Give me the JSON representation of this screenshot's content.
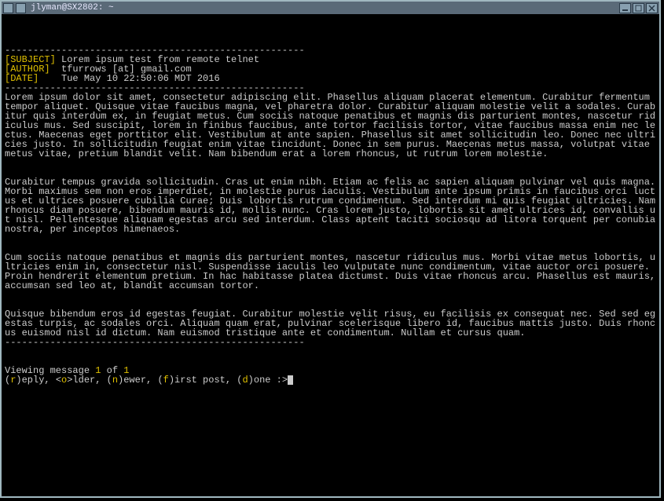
{
  "titlebar": {
    "title": "jlyman@SX2802: ~"
  },
  "header": {
    "rule": "-----------------------------------------------------",
    "subject_label": "[SUBJECT]",
    "subject_value": "Lorem ipsum test from remote telnet",
    "author_label": "[AUTHOR]",
    "author_value": "tfurrows [at] gmail.com",
    "date_label": "[DATE]",
    "date_value": "Tue May 10 22:50:06 MDT 2016"
  },
  "body": {
    "para1": "Lorem ipsum dolor sit amet, consectetur adipiscing elit. Phasellus aliquam placerat elementum. Curabitur fermentum tempor aliquet. Quisque vitae faucibus magna, vel pharetra dolor. Curabitur aliquam molestie velit a sodales. Curabitur quis interdum ex, in feugiat metus. Cum sociis natoque penatibus et magnis dis parturient montes, nascetur ridiculus mus. Sed suscipit, lorem in finibus faucibus, ante tortor facilisis tortor, vitae faucibus massa enim nec lectus. Maecenas eget porttitor elit. Vestibulum at ante sapien. Phasellus sit amet sollicitudin leo. Donec nec ultricies justo. In sollicitudin feugiat enim vitae tincidunt. Donec in sem purus. Maecenas metus massa, volutpat vitae metus vitae, pretium blandit velit. Nam bibendum erat a lorem rhoncus, ut rutrum lorem molestie.",
    "para2": "Curabitur tempus gravida sollicitudin. Cras ut enim nibh. Etiam ac felis ac sapien aliquam pulvinar vel quis magna. Morbi maximus sem non eros imperdiet, in molestie purus iaculis. Vestibulum ante ipsum primis in faucibus orci luctus et ultrices posuere cubilia Curae; Duis lobortis rutrum condimentum. Sed interdum mi quis feugiat ultricies. Nam rhoncus diam posuere, bibendum mauris id, mollis nunc. Cras lorem justo, lobortis sit amet ultrices id, convallis ut nisl. Pellentesque aliquam egestas arcu sed interdum. Class aptent taciti sociosqu ad litora torquent per conubia nostra, per inceptos himenaeos.",
    "para3": "Cum sociis natoque penatibus et magnis dis parturient montes, nascetur ridiculus mus. Morbi vitae metus lobortis, ultricies enim in, consectetur nisl. Suspendisse iaculis leo vulputate nunc condimentum, vitae auctor orci posuere. Proin hendrerit elementum pretium. In hac habitasse platea dictumst. Duis vitae rhoncus arcu. Phasellus est mauris, accumsan sed leo at, blandit accumsan tortor.",
    "para4": "Quisque bibendum eros id egestas feugiat. Curabitur molestie velit risus, eu facilisis ex consequat nec. Sed sed egestas turpis, ac sodales orci. Aliquam quam erat, pulvinar scelerisque libero id, faucibus mattis justo. Duis rhoncus euismod nisl id dictum. Nam euismod tristique ante et condimentum. Nullam et cursus quam."
  },
  "footer": {
    "rule": "-----------------------------------------------------",
    "viewing_prefix": "Viewing message ",
    "current": "1",
    "of_text": " of ",
    "total": "1",
    "menu": {
      "open1": "(",
      "r": "r",
      "reply": ")eply, <",
      "o": "o",
      "older": ">lder, (",
      "n": "n",
      "newer": ")ewer, (",
      "f": "f",
      "first": ")irst post, (",
      "d": "d",
      "done": ")one :>"
    }
  }
}
